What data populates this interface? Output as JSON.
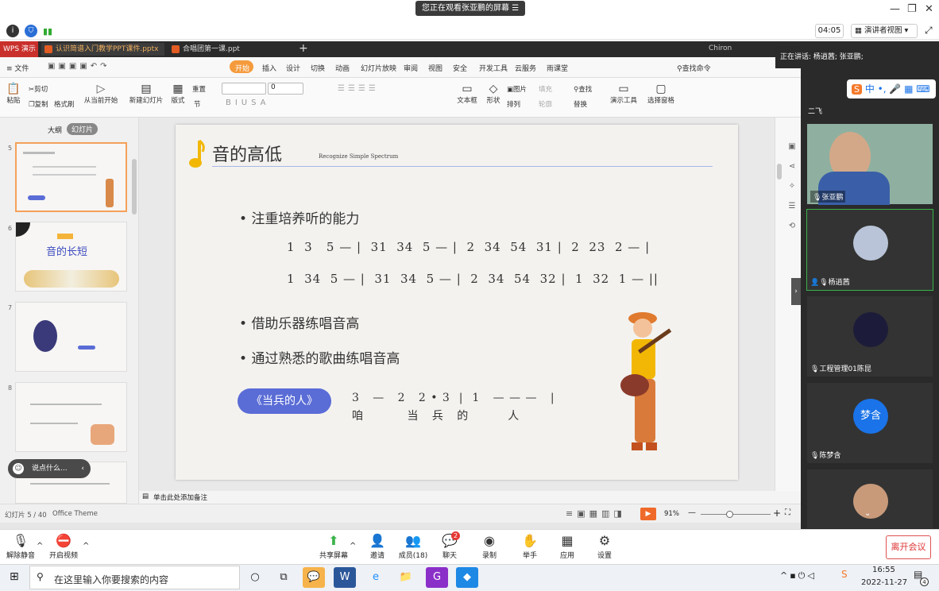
{
  "meeting_top": {
    "share_banner": "您正在观看张亚鹏的屏幕",
    "timer": "04:05",
    "presenter_view": "演讲者视图"
  },
  "wps": {
    "app_tab": "WPS 演示",
    "doc_tabs": [
      "认识简谱入门教学PPT课件.pptx",
      "合唱团第一课.ppt"
    ],
    "user": "Chiron",
    "menu_file": "文件",
    "menu_items": [
      "开始",
      "插入",
      "设计",
      "切换",
      "动画",
      "幻灯片放映",
      "审阅",
      "视图",
      "安全",
      "开发工具",
      "云服务",
      "雨课堂"
    ],
    "search_cmd": "查找命令",
    "ribbon": {
      "paste": "粘贴",
      "cut": "剪切",
      "copy": "复制",
      "format_painter": "格式刷",
      "play_from_current": "从当前开始",
      "new_slide": "新建幻灯片",
      "layout": "版式",
      "section": "节",
      "reset": "重置",
      "font_size": "0",
      "textbox": "文本框",
      "shape": "形状",
      "picture": "图片",
      "arrange": "排列",
      "fill": "填充",
      "outline": "轮廓",
      "find": "查找",
      "replace": "替换",
      "present_tool": "演示工具",
      "select_pane": "选择窗格"
    },
    "left_tabs": [
      "大纲",
      "幻灯片"
    ],
    "thumbs": [
      {
        "num": "5",
        "title": ""
      },
      {
        "num": "6",
        "title": "音的长短"
      },
      {
        "num": "7",
        "title": ""
      },
      {
        "num": "8",
        "title": ""
      },
      {
        "num": "9",
        "title": ""
      }
    ],
    "comment_placeholder": "说点什么...",
    "notes_placeholder": "单击此处添加备注",
    "status_slide": "幻灯片 5 / 40",
    "status_theme": "Office Theme",
    "zoom": "91%"
  },
  "slide": {
    "title": "音的高低",
    "subtitle": "Recognize Simple Spectrum",
    "bullet1": "注重培养听的能力",
    "line1": "1  3   5 — |  31  34  5 — |  2  34  54  31 |  2  23  2 — |",
    "line2": "1  34  5 — |  31  34  5 — |  2  34  54  32 |  1  32  1 — ||",
    "bullet2": "借助乐器练唱音高",
    "bullet3": "通过熟悉的歌曲练唱音高",
    "song_button": "《当兵的人》",
    "song_notes": "3   —   2   2 • 3  |  1   — — —   |",
    "song_lyrics": "咱          当   兵   的         人"
  },
  "meeting_panel": {
    "speaking": "正在讲话: 杨逍茜; 张亚鹏;",
    "participants": [
      "二飞",
      "张亚鹏",
      "杨逍茜",
      "工程管理01陈昆",
      "陈梦含",
      ""
    ],
    "avatar_text": "梦含"
  },
  "meeting_toolbar": {
    "mute": "解除静音",
    "video": "开启视频",
    "share": "共享屏幕",
    "invite": "邀请",
    "members": "成员(18)",
    "chat": "聊天",
    "chat_badge": "2",
    "record": "录制",
    "raise": "举手",
    "apps": "应用",
    "settings": "设置",
    "leave": "离开会议",
    "ime": "中"
  },
  "taskbar": {
    "search": "在这里输入你要搜索的内容",
    "time": "16:55",
    "date": "2022-11-27",
    "notif": "4",
    "clock_small": "16:55"
  }
}
